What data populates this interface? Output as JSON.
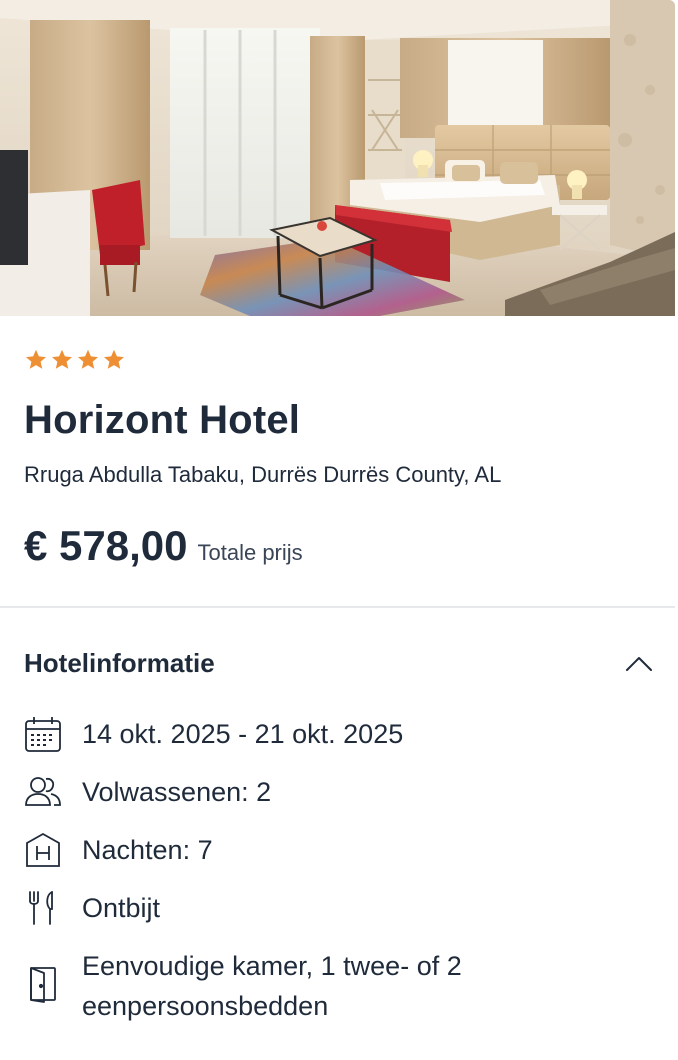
{
  "hotel": {
    "rating_stars": 4,
    "star_color": "#ee8f33",
    "name": "Horizont Hotel",
    "address": "Rruga Abdulla Tabaku, Durrës Durrës County, AL",
    "price": "€ 578,00",
    "price_label": "Totale prijs",
    "image_alt": "hotel-room-photo"
  },
  "hotel_info": {
    "title": "Hotelinformatie",
    "expanded": true,
    "items": [
      {
        "icon": "calendar-icon",
        "text": "14 okt. 2025 - 21 okt. 2025"
      },
      {
        "icon": "users-icon",
        "text": "Volwassenen: 2"
      },
      {
        "icon": "hotel-icon",
        "text": "Nachten: 7"
      },
      {
        "icon": "cutlery-icon",
        "text": "Ontbijt"
      },
      {
        "icon": "door-icon",
        "text": "Eenvoudige kamer, 1 twee- of 2 eenpersoonsbedden"
      }
    ]
  },
  "colors": {
    "text_primary": "#1f2a3a",
    "divider": "#e6e8ec",
    "star": "#ee8f33"
  }
}
